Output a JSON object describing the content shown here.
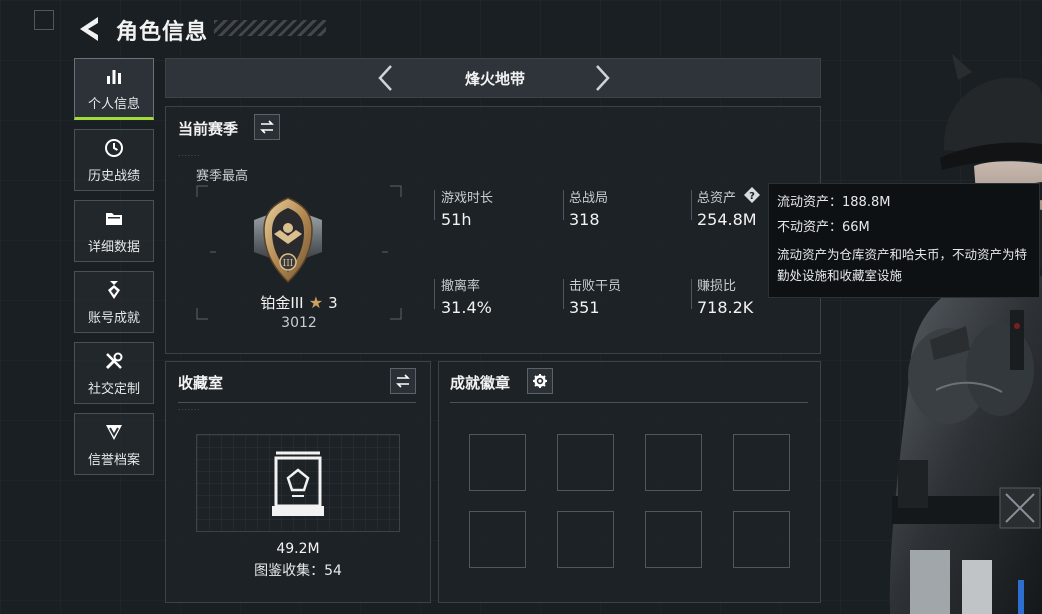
{
  "header": {
    "title": "角色信息"
  },
  "sidebar": {
    "items": [
      {
        "label": "个人信息",
        "icon": "bar-chart-icon",
        "active": true
      },
      {
        "label": "历史战绩",
        "icon": "clock-icon"
      },
      {
        "label": "详细数据",
        "icon": "folder-icon"
      },
      {
        "label": "账号成就",
        "icon": "medal-icon"
      },
      {
        "label": "社交定制",
        "icon": "tools-icon"
      },
      {
        "label": "信誉档案",
        "icon": "shield-icon"
      }
    ]
  },
  "mode": {
    "title": "烽火地带"
  },
  "season": {
    "title": "当前赛季",
    "highest_label": "赛季最高",
    "rank_name": "铂金III",
    "rank_stars": "3",
    "rank_points": "3012",
    "stats": [
      {
        "label": "游戏时长",
        "value": "51h"
      },
      {
        "label": "总战局",
        "value": "318"
      },
      {
        "label": "总资产",
        "value": "254.8M"
      },
      {
        "label": "撤离率",
        "value": "31.4%"
      },
      {
        "label": "击败干员",
        "value": "351"
      },
      {
        "label": "赚损比",
        "value": "718.2K"
      }
    ]
  },
  "tooltip": {
    "liquid": "流动资产：188.8M",
    "fixed": "不动资产：66M",
    "desc": "流动资产为仓库资产和哈夫币，不动资产为特勤处设施和收藏室设施"
  },
  "collection": {
    "title": "收藏室",
    "value": "49.2M",
    "catalog": "图鉴收集：54"
  },
  "achievements": {
    "title": "成就徽章",
    "slots": 8
  },
  "colors": {
    "accent": "#9fdc3c",
    "gold": "#c9a060",
    "panel": "#1e2327"
  }
}
